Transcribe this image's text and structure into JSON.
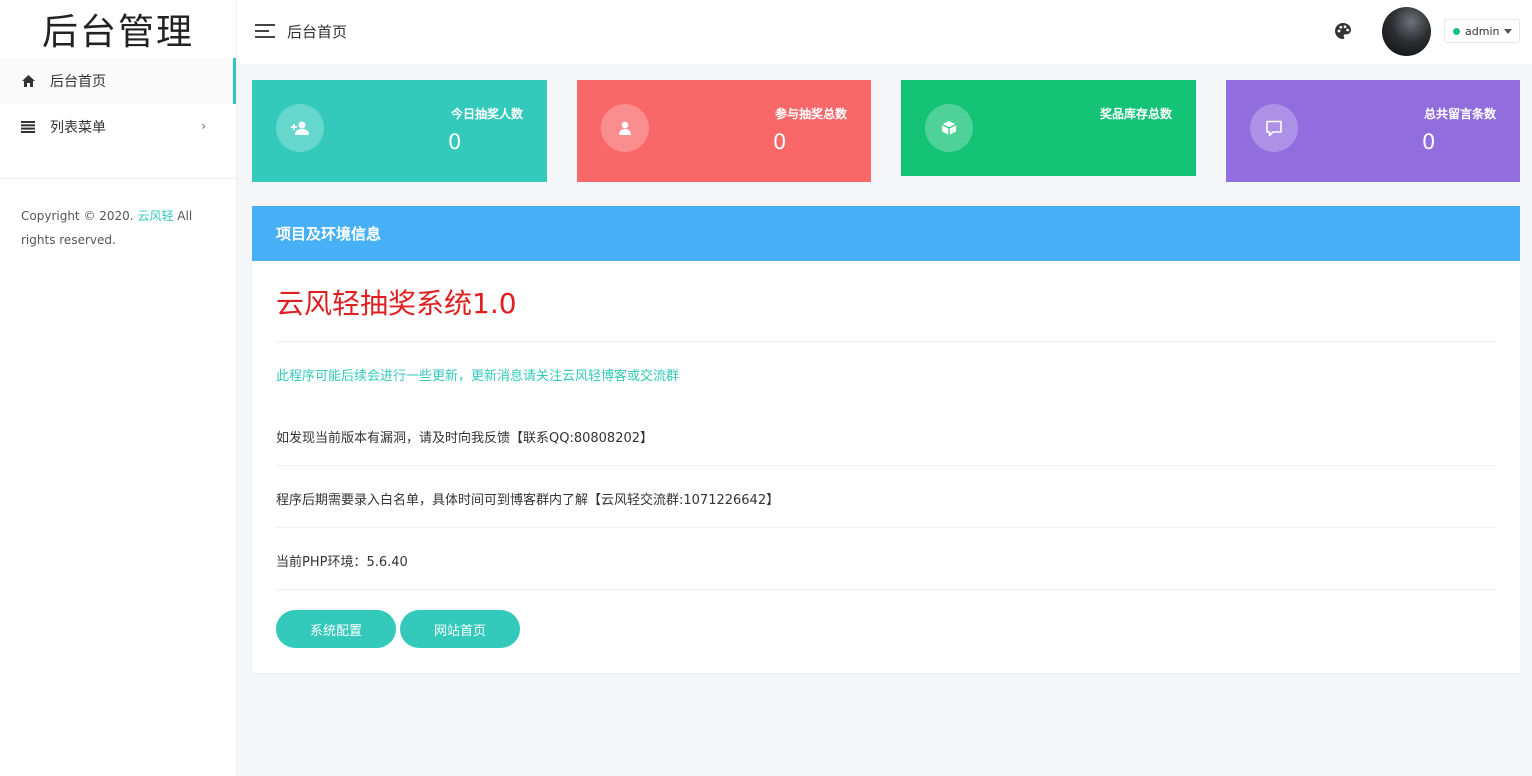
{
  "brand": "后台管理",
  "sidebar": {
    "items": [
      {
        "label": "后台首页",
        "icon": "home-icon"
      },
      {
        "label": "列表菜单",
        "icon": "list-icon"
      }
    ],
    "copyright_prefix": "Copyright © 2020.",
    "copyright_brand": "云风轻",
    "copyright_suffix": "All rights reserved."
  },
  "header": {
    "title": "后台首页",
    "user": "admin"
  },
  "cards": [
    {
      "label": "今日抽奖人数",
      "value": "0",
      "color": "#33cabb",
      "icon": "add-user-icon"
    },
    {
      "label": "参与抽奖总数",
      "value": "0",
      "color": "#f96868",
      "icon": "user-icon"
    },
    {
      "label": "奖品库存总数",
      "value": "",
      "color": "#15c377",
      "icon": "box-icon"
    },
    {
      "label": "总共留言条数",
      "value": "0",
      "color": "#926dde",
      "icon": "message-icon"
    }
  ],
  "panel": {
    "heading": "项目及环境信息",
    "title": "云风轻抽奖系统1.0",
    "notice": "此程序可能后续会进行一些更新，更新消息请关注云风轻博客或交流群",
    "feedback": "如发现当前版本有漏洞，请及时向我反馈【联系QQ:80808202】",
    "whitelist": "程序后期需要录入白名单，具体时间可到博客群内了解【云风轻交流群:1071226642】",
    "php": "当前PHP环境：5.6.40",
    "buttons": [
      "系统配置",
      "网站首页"
    ]
  },
  "colors": {
    "accent": "#33cabb",
    "panel_header": "#48b0f7",
    "title_red": "#e02020"
  }
}
